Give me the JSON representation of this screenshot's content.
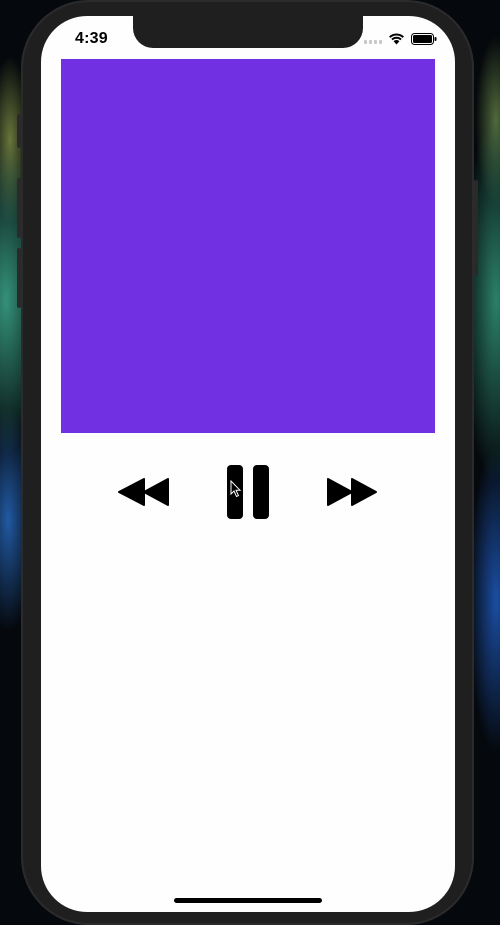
{
  "status_bar": {
    "time": "4:39",
    "icons": [
      "signal-icon",
      "wifi-icon",
      "battery-icon"
    ]
  },
  "player": {
    "artwork_color": "#7130e1",
    "controls": [
      "rewind-icon",
      "pause-icon",
      "fast-forward-icon"
    ],
    "state": "playing"
  }
}
